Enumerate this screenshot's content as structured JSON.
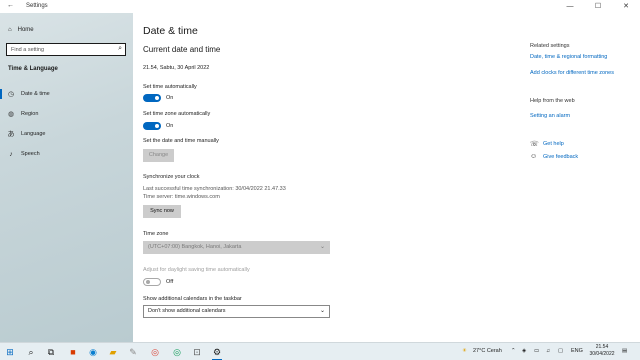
{
  "window": {
    "title": "Settings",
    "back_glyph": "←",
    "minimize": "—",
    "maximize": "☐",
    "close": "✕"
  },
  "sidebar": {
    "home": "Home",
    "search_placeholder": "Find a setting",
    "section": "Time & Language",
    "items": [
      {
        "label": "Date & time",
        "icon": "clock-icon"
      },
      {
        "label": "Region",
        "icon": "globe-icon"
      },
      {
        "label": "Language",
        "icon": "language-icon"
      },
      {
        "label": "Speech",
        "icon": "microphone-icon"
      }
    ]
  },
  "main": {
    "title": "Date & time",
    "section_title": "Current date and time",
    "current_datetime": "21.54, Sabtu, 30 April 2022",
    "set_time_auto": {
      "label": "Set time automatically",
      "state": "On"
    },
    "set_tz_auto": {
      "label": "Set time zone automatically",
      "state": "On"
    },
    "manual": {
      "label": "Set the date and time manually",
      "button": "Change"
    },
    "sync": {
      "title": "Synchronize your clock",
      "last_sync": "Last successful time synchronization: 30/04/2022 21.47.33",
      "server": "Time server: time.windows.com",
      "button": "Sync now"
    },
    "timezone": {
      "label": "Time zone",
      "value": "(UTC+07:00) Bangkok, Hanoi, Jakarta"
    },
    "dst": {
      "label": "Adjust for daylight saving time automatically",
      "state": "Off"
    },
    "calendars": {
      "label": "Show additional calendars in the taskbar",
      "value": "Don't show additional calendars"
    }
  },
  "related": {
    "heading": "Related settings",
    "links": [
      "Date, time & regional formatting",
      "Add clocks for different time zones"
    ],
    "help_heading": "Help from the web",
    "help_link": "Setting an alarm",
    "get_help": "Get help",
    "feedback": "Give feedback"
  },
  "taskbar": {
    "weather": "27°C Cerah",
    "lang": "ENG",
    "time": "21.54",
    "date": "30/04/2022"
  }
}
